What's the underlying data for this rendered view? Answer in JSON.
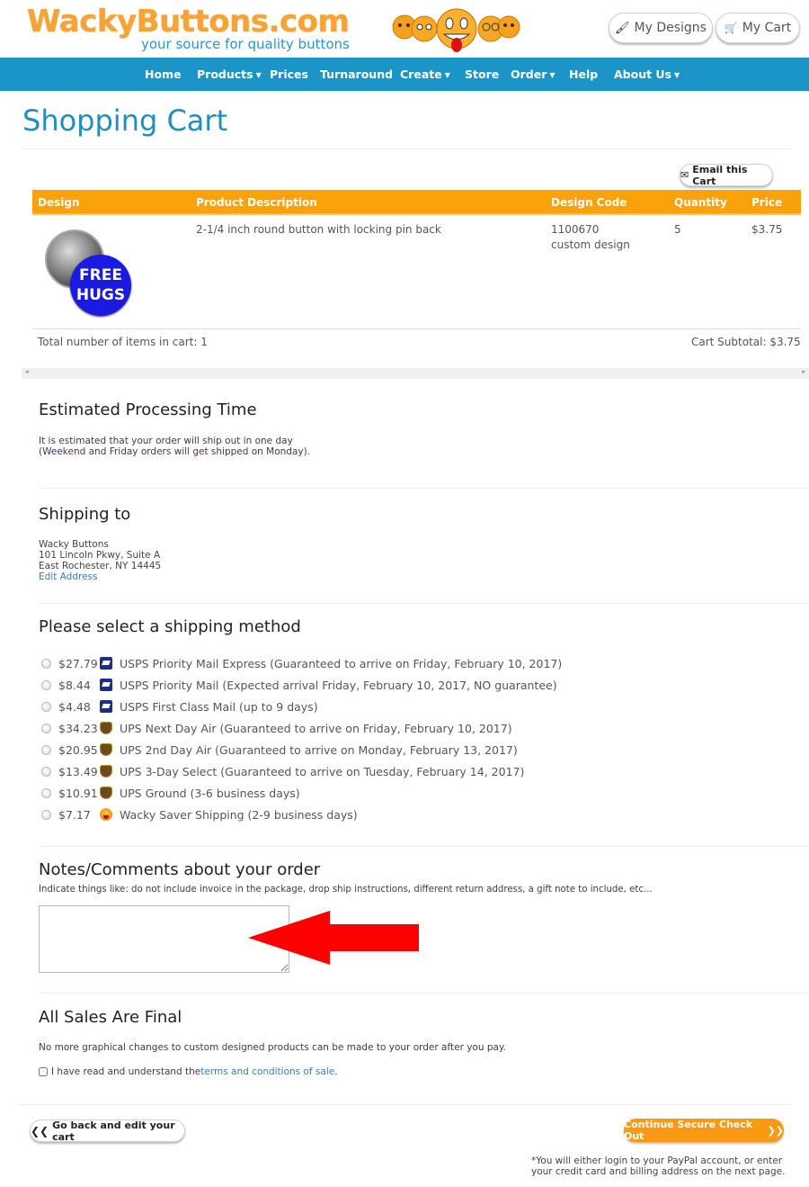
{
  "header": {
    "logo_text": "WackyButtons.com",
    "tagline": "your source for quality buttons",
    "my_designs_label": "My Designs",
    "my_cart_label": "My Cart"
  },
  "nav": {
    "items": [
      {
        "label": "Home",
        "dropdown": false
      },
      {
        "label": "Products",
        "dropdown": true
      },
      {
        "label": "Prices",
        "dropdown": false
      },
      {
        "label": "Turnaround",
        "dropdown": false
      },
      {
        "label": "Create",
        "dropdown": true
      },
      {
        "label": "Store",
        "dropdown": false
      },
      {
        "label": "Order",
        "dropdown": true
      },
      {
        "label": "Help",
        "dropdown": false
      },
      {
        "label": "About Us",
        "dropdown": true
      }
    ],
    "caret": "▼"
  },
  "page_title": "Shopping Cart",
  "cart": {
    "email_label": "Email this Cart",
    "columns": [
      "Design",
      "Product Description",
      "Design Code",
      "Quantity",
      "Price"
    ],
    "rows": [
      {
        "design_text_line1": "FREE",
        "design_text_line2": "HUGS",
        "description": "2-1/4 inch round button with locking pin back",
        "design_code": "1100670",
        "design_code_note": "custom design",
        "quantity": "5",
        "price": "$3.75"
      }
    ],
    "total_items_label": "Total number of items in cart: 1",
    "subtotal_label": "Cart Subtotal: $3.75"
  },
  "processing": {
    "heading": "Estimated Processing Time",
    "line1": "It is estimated that your order will ship out in one day",
    "line2": "(Weekend and Friday orders will get shipped on Monday)."
  },
  "shipping_to": {
    "heading": "Shipping to",
    "name": "Wacky Buttons",
    "street": "101 Lincoln Pkwy, Suite A",
    "city": "East Rochester, NY 14445",
    "edit_label": "Edit Address"
  },
  "shipping_method": {
    "heading": "Please select a shipping method",
    "options": [
      {
        "price": "$27.79",
        "carrier": "usps",
        "label": "USPS Priority Mail Express (Guaranteed to arrive on Friday, February 10, 2017)"
      },
      {
        "price": "$8.44",
        "carrier": "usps",
        "label": "USPS Priority Mail (Expected arrival Friday, February 10, 2017, NO guarantee)"
      },
      {
        "price": "$4.48",
        "carrier": "usps",
        "label": "USPS First Class Mail (up to 9 days)"
      },
      {
        "price": "$34.23",
        "carrier": "ups",
        "label": "UPS Next Day Air (Guaranteed to arrive on Friday, February 10, 2017)"
      },
      {
        "price": "$20.95",
        "carrier": "ups",
        "label": "UPS 2nd Day Air (Guaranteed to arrive on Monday, February 13, 2017)"
      },
      {
        "price": "$13.49",
        "carrier": "ups",
        "label": "UPS 3-Day Select (Guaranteed to arrive on Tuesday, February 14, 2017)"
      },
      {
        "price": "$10.91",
        "carrier": "ups",
        "label": "UPS Ground (3-6 business days)"
      },
      {
        "price": "$7.17",
        "carrier": "wacky",
        "label": "Wacky Saver Shipping (2-9 business days)"
      }
    ]
  },
  "notes": {
    "heading": "Notes/Comments about your order",
    "hint": "Indicate things like: do not include invoice in the package, drop ship instructions, different return address, a gift note to include, etc...",
    "value": "",
    "arrow_color": "#ff0000"
  },
  "final": {
    "heading": "All Sales Are Final",
    "text": "No more graphical changes to custom designed products can be made to your order after you pay.",
    "checkbox_prefix": "I have read and understand the ",
    "terms_link": "terms and conditions of sale",
    "checkbox_suffix": ".",
    "checked": false
  },
  "footer": {
    "back_label": "Go back and edit your cart",
    "checkout_label": "Continue Secure Check Out",
    "note_line1": "*You will either login to your PayPal account, or enter",
    "note_line2": "your credit card and billing address on the next page."
  },
  "colors": {
    "brand_orange": "#fba20a",
    "brand_blue": "#1b95c7",
    "checkout_orange": "#fa9a12"
  }
}
